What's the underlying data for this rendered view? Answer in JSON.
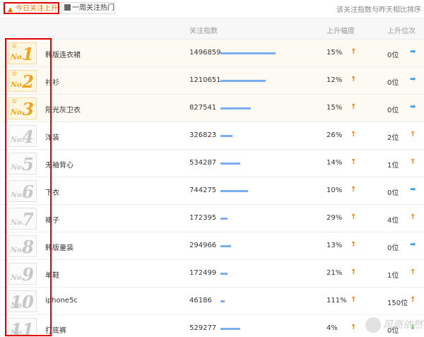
{
  "tabs": [
    {
      "label": "今日关注上升",
      "active": true
    },
    {
      "label": "一周关注热门",
      "active": false
    }
  ],
  "rule_note": "该关注指数与昨天相比排序",
  "headers": {
    "index": "关注指数",
    "up_rate": "上升幅度",
    "position_up": "上升位次"
  },
  "rows": [
    {
      "rank": "1",
      "no": "No.",
      "keyword": "韩版连衣裙",
      "index": "1496859",
      "index_fraction": 0.56,
      "up_rate": "15%",
      "position": "0位",
      "position_trend": "right"
    },
    {
      "rank": "2",
      "no": "No.",
      "keyword": "衬衫",
      "index": "1210651",
      "index_fraction": 0.46,
      "up_rate": "12%",
      "position": "0位",
      "position_trend": "right"
    },
    {
      "rank": "3",
      "no": "No.",
      "keyword": "阳光灰卫衣",
      "index": "827541",
      "index_fraction": 0.31,
      "up_rate": "15%",
      "position": "0位",
      "position_trend": "right"
    },
    {
      "rank": "4",
      "no": "No.",
      "keyword": "洋装",
      "index": "326823",
      "index_fraction": 0.12,
      "up_rate": "26%",
      "position": "2位",
      "position_trend": "up"
    },
    {
      "rank": "5",
      "no": "No.",
      "keyword": "无袖背心",
      "index": "534287",
      "index_fraction": 0.2,
      "up_rate": "14%",
      "position": "1位",
      "position_trend": "up"
    },
    {
      "rank": "6",
      "no": "No.",
      "keyword": "下衣",
      "index": "744275",
      "index_fraction": 0.28,
      "up_rate": "10%",
      "position": "0位",
      "position_trend": "right"
    },
    {
      "rank": "7",
      "no": "No.",
      "keyword": "裙子",
      "index": "172395",
      "index_fraction": 0.07,
      "up_rate": "29%",
      "position": "4位",
      "position_trend": "up"
    },
    {
      "rank": "8",
      "no": "No.",
      "keyword": "韩版童装",
      "index": "294966",
      "index_fraction": 0.11,
      "up_rate": "13%",
      "position": "0位",
      "position_trend": "right"
    },
    {
      "rank": "9",
      "no": "No.",
      "keyword": "单鞋",
      "index": "172499",
      "index_fraction": 0.07,
      "up_rate": "21%",
      "position": "1位",
      "position_trend": "up"
    },
    {
      "rank": "10",
      "no": "No.",
      "keyword": "iphone5c",
      "index": "46186",
      "index_fraction": 0.02,
      "up_rate": "111%",
      "position": "150位",
      "position_trend": "up"
    },
    {
      "rank": "11",
      "no": "No.",
      "keyword": "打底裤",
      "index": "529277",
      "index_fraction": 0.2,
      "up_rate": "4%",
      "position": "0位",
      "position_trend": "down"
    }
  ],
  "watermark": "风商依然",
  "colors": {
    "accent_orange": "#f07b0e",
    "bar_blue": "#7aaef0",
    "highlight_red": "#e00000",
    "arrow_blue": "#2fa0e8",
    "arrow_green": "#3cae3c"
  }
}
